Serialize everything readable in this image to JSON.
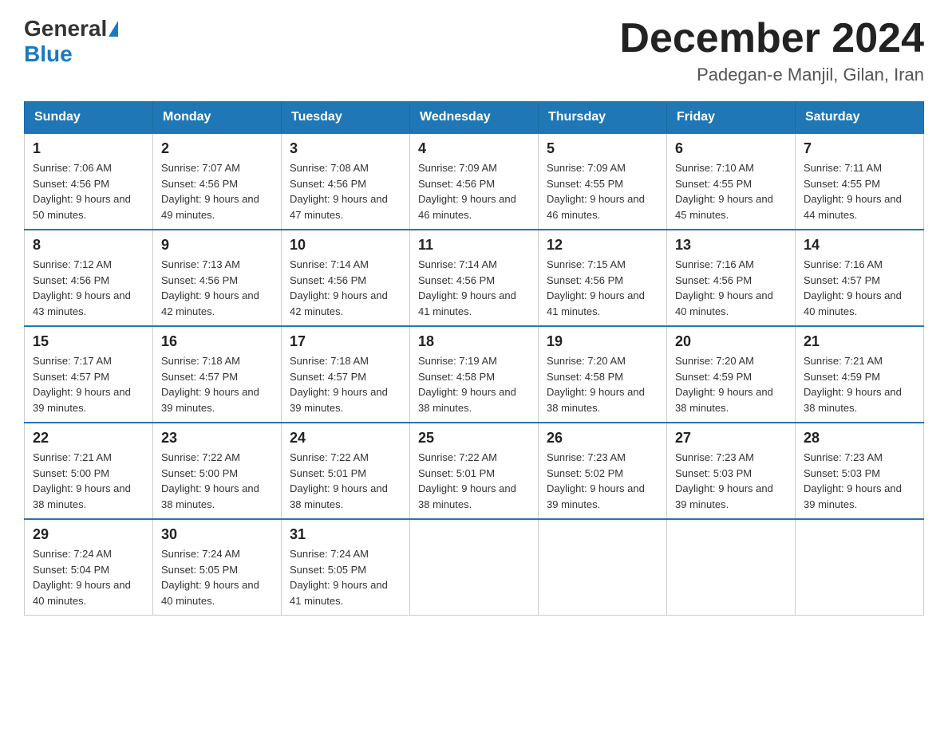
{
  "header": {
    "logo_general": "General",
    "logo_blue": "Blue",
    "month_title": "December 2024",
    "location": "Padegan-e Manjil, Gilan, Iran"
  },
  "days_of_week": [
    "Sunday",
    "Monday",
    "Tuesday",
    "Wednesday",
    "Thursday",
    "Friday",
    "Saturday"
  ],
  "weeks": [
    [
      {
        "day": "1",
        "sunrise": "7:06 AM",
        "sunset": "4:56 PM",
        "daylight": "9 hours and 50 minutes."
      },
      {
        "day": "2",
        "sunrise": "7:07 AM",
        "sunset": "4:56 PM",
        "daylight": "9 hours and 49 minutes."
      },
      {
        "day": "3",
        "sunrise": "7:08 AM",
        "sunset": "4:56 PM",
        "daylight": "9 hours and 47 minutes."
      },
      {
        "day": "4",
        "sunrise": "7:09 AM",
        "sunset": "4:56 PM",
        "daylight": "9 hours and 46 minutes."
      },
      {
        "day": "5",
        "sunrise": "7:09 AM",
        "sunset": "4:55 PM",
        "daylight": "9 hours and 46 minutes."
      },
      {
        "day": "6",
        "sunrise": "7:10 AM",
        "sunset": "4:55 PM",
        "daylight": "9 hours and 45 minutes."
      },
      {
        "day": "7",
        "sunrise": "7:11 AM",
        "sunset": "4:55 PM",
        "daylight": "9 hours and 44 minutes."
      }
    ],
    [
      {
        "day": "8",
        "sunrise": "7:12 AM",
        "sunset": "4:56 PM",
        "daylight": "9 hours and 43 minutes."
      },
      {
        "day": "9",
        "sunrise": "7:13 AM",
        "sunset": "4:56 PM",
        "daylight": "9 hours and 42 minutes."
      },
      {
        "day": "10",
        "sunrise": "7:14 AM",
        "sunset": "4:56 PM",
        "daylight": "9 hours and 42 minutes."
      },
      {
        "day": "11",
        "sunrise": "7:14 AM",
        "sunset": "4:56 PM",
        "daylight": "9 hours and 41 minutes."
      },
      {
        "day": "12",
        "sunrise": "7:15 AM",
        "sunset": "4:56 PM",
        "daylight": "9 hours and 41 minutes."
      },
      {
        "day": "13",
        "sunrise": "7:16 AM",
        "sunset": "4:56 PM",
        "daylight": "9 hours and 40 minutes."
      },
      {
        "day": "14",
        "sunrise": "7:16 AM",
        "sunset": "4:57 PM",
        "daylight": "9 hours and 40 minutes."
      }
    ],
    [
      {
        "day": "15",
        "sunrise": "7:17 AM",
        "sunset": "4:57 PM",
        "daylight": "9 hours and 39 minutes."
      },
      {
        "day": "16",
        "sunrise": "7:18 AM",
        "sunset": "4:57 PM",
        "daylight": "9 hours and 39 minutes."
      },
      {
        "day": "17",
        "sunrise": "7:18 AM",
        "sunset": "4:57 PM",
        "daylight": "9 hours and 39 minutes."
      },
      {
        "day": "18",
        "sunrise": "7:19 AM",
        "sunset": "4:58 PM",
        "daylight": "9 hours and 38 minutes."
      },
      {
        "day": "19",
        "sunrise": "7:20 AM",
        "sunset": "4:58 PM",
        "daylight": "9 hours and 38 minutes."
      },
      {
        "day": "20",
        "sunrise": "7:20 AM",
        "sunset": "4:59 PM",
        "daylight": "9 hours and 38 minutes."
      },
      {
        "day": "21",
        "sunrise": "7:21 AM",
        "sunset": "4:59 PM",
        "daylight": "9 hours and 38 minutes."
      }
    ],
    [
      {
        "day": "22",
        "sunrise": "7:21 AM",
        "sunset": "5:00 PM",
        "daylight": "9 hours and 38 minutes."
      },
      {
        "day": "23",
        "sunrise": "7:22 AM",
        "sunset": "5:00 PM",
        "daylight": "9 hours and 38 minutes."
      },
      {
        "day": "24",
        "sunrise": "7:22 AM",
        "sunset": "5:01 PM",
        "daylight": "9 hours and 38 minutes."
      },
      {
        "day": "25",
        "sunrise": "7:22 AM",
        "sunset": "5:01 PM",
        "daylight": "9 hours and 38 minutes."
      },
      {
        "day": "26",
        "sunrise": "7:23 AM",
        "sunset": "5:02 PM",
        "daylight": "9 hours and 39 minutes."
      },
      {
        "day": "27",
        "sunrise": "7:23 AM",
        "sunset": "5:03 PM",
        "daylight": "9 hours and 39 minutes."
      },
      {
        "day": "28",
        "sunrise": "7:23 AM",
        "sunset": "5:03 PM",
        "daylight": "9 hours and 39 minutes."
      }
    ],
    [
      {
        "day": "29",
        "sunrise": "7:24 AM",
        "sunset": "5:04 PM",
        "daylight": "9 hours and 40 minutes."
      },
      {
        "day": "30",
        "sunrise": "7:24 AM",
        "sunset": "5:05 PM",
        "daylight": "9 hours and 40 minutes."
      },
      {
        "day": "31",
        "sunrise": "7:24 AM",
        "sunset": "5:05 PM",
        "daylight": "9 hours and 41 minutes."
      },
      null,
      null,
      null,
      null
    ]
  ]
}
